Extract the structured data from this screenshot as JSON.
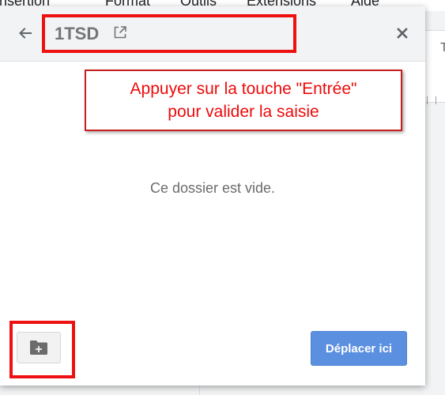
{
  "background": {
    "menu_items": [
      "Insertion",
      "Format",
      "Outils",
      "Extensions",
      "Aide"
    ],
    "ruler_glyph": "T"
  },
  "dialog": {
    "title": "1TSD",
    "empty_message": "Ce dossier est vide.",
    "move_button_label": "Déplacer ici"
  },
  "annotation": {
    "callout_line1": "Appuyer sur la touche \"Entrée\"",
    "callout_line2": "pour valider la saisie"
  },
  "colors": {
    "annotation_red": "#ee1111",
    "primary_button": "#5b8fe0",
    "header_bg": "#f1f3f4"
  }
}
